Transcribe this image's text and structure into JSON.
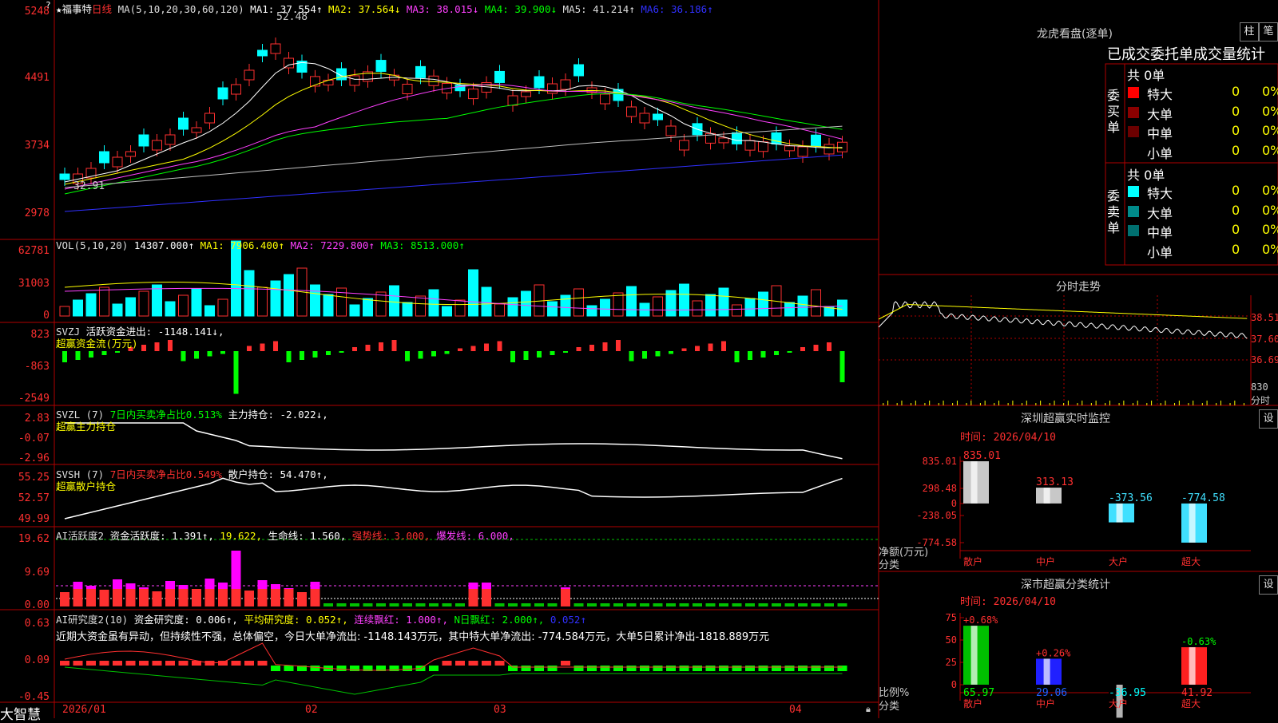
{
  "app": {
    "brand": "大智慧"
  },
  "kline_header": {
    "star": "★",
    "stock_name": "福事特",
    "period": "日线",
    "ma_label": "MA(5,10,20,30,60,120)",
    "ma1": "MA1: 37.554↑",
    "ma2": "MA2: 37.564↓",
    "ma3": "MA3: 38.015↓",
    "ma4": "MA4: 39.900↓",
    "ma5": "MA5: 41.214↑",
    "ma6": "MA6: 36.186↑",
    "high_mark": "52.48",
    "low_mark": "32.91",
    "question_mark": "?"
  },
  "kline_yaxis": [
    "5248",
    "4491",
    "3734",
    "2978"
  ],
  "vol_header": {
    "label": "VOL(5,10,20)",
    "value": "14307.000↑",
    "ma1": "MA1: 7906.400↑",
    "ma2": "MA2: 7229.800↑",
    "ma3": "MA3: 8513.000↑"
  },
  "vol_yaxis": [
    "62781",
    "31003",
    "0"
  ],
  "svzj_header": {
    "label": "SVZJ",
    "text": "活跃资金进出: -1148.141↓,",
    "sub": "超赢资金流(万元)"
  },
  "svzj_yaxis": [
    "823",
    "-863",
    "-2549"
  ],
  "svzl_header": {
    "label": "SVZL (7)",
    "text1": "7日内买卖净占比0.513%",
    "text2": "主力持仓: -2.022↓,",
    "sub": "超赢主力持仓"
  },
  "svzl_yaxis": [
    "2.83",
    "-0.07",
    "-2.96"
  ],
  "svsh_header": {
    "label": "SVSH (7)",
    "text1": "7日内买卖净占比0.549%",
    "text2": "散户持仓: 54.470↑,",
    "sub": "超赢散户持仓"
  },
  "svsh_yaxis": [
    "55.25",
    "52.57",
    "49.99"
  ],
  "ai_active_header": {
    "label": "AI活跃度2",
    "t1": "资金活跃度: 1.391↑,",
    "t2": "19.622,",
    "t3": "生命线: 1.560,",
    "t4": "强势线: 3.000,",
    "t5": "爆发线: 6.000,"
  },
  "ai_active_yaxis": [
    "19.62",
    "9.69",
    "0.00"
  ],
  "ai_research_header": {
    "label": "AI研究度2(10)",
    "t1": "资金研究度: 0.006↑,",
    "t2": "平均研究度: 0.052↑,",
    "t3": "连续飘红: 1.000↑,",
    "t4": "N日飘红: 2.000↑,",
    "t5": "0.052↑",
    "comment": "近期大资金虽有异动，但持续性不强，总体偏空，今日大单净流出: -1148.143万元，其中特大单净流出: -774.584万元，大单5日累计净出-1818.889万元"
  },
  "ai_research_yaxis": [
    "0.63",
    "0.09",
    "-0.45"
  ],
  "xaxis": [
    "2026/01",
    "02",
    "03",
    "04"
  ],
  "dragon": {
    "title": "龙虎看盘(逐单)",
    "btn1": "柱",
    "btn2": "笔",
    "subtitle": "已成交委托单成交量统计",
    "buy_label": "委买单",
    "sell_label": "委卖单",
    "buy_total": "共 0单",
    "sell_total": "共 0单",
    "buy_rows": [
      {
        "name": "特大",
        "qty": "0",
        "pct": "0%",
        "color": "#ff0000"
      },
      {
        "name": "大单",
        "qty": "0",
        "pct": "0%",
        "color": "#8b0000"
      },
      {
        "name": "中单",
        "qty": "0",
        "pct": "0%",
        "color": "#6b0000"
      },
      {
        "name": "小单",
        "qty": "0",
        "pct": "0%",
        "color": "#000000"
      }
    ],
    "sell_rows": [
      {
        "name": "特大",
        "qty": "0",
        "pct": "0%",
        "color": "#00ffff"
      },
      {
        "name": "大单",
        "qty": "0",
        "pct": "0%",
        "color": "#008b8b"
      },
      {
        "name": "中单",
        "qty": "0",
        "pct": "0%",
        "color": "#007070"
      },
      {
        "name": "小单",
        "qty": "0",
        "pct": "0%",
        "color": "#000000"
      }
    ]
  },
  "minute": {
    "title": "分时走势",
    "y": [
      "38.51",
      "37.60",
      "36.69"
    ],
    "vol": "830",
    "vol_label": "分时"
  },
  "sz_monitor": {
    "title": "深圳超赢实时监控",
    "btn": "设",
    "time": "时间: 2026/04/10",
    "yaxis": [
      "835.01",
      "298.48",
      "0",
      "-238.05",
      "-774.58"
    ],
    "ylabel": "净额(万元)",
    "xlabel": "分类",
    "categories": [
      "散户",
      "中户",
      "大户",
      "超大"
    ],
    "values": [
      835.01,
      313.13,
      -373.56,
      -774.58
    ],
    "value_labels": [
      "835.01",
      "313.13",
      "-373.56",
      "-774.58"
    ]
  },
  "sz_class": {
    "title": "深市超赢分类统计",
    "btn": "设",
    "time": "时间: 2026/04/10",
    "yaxis": [
      "75",
      "50",
      "25",
      "0"
    ],
    "ylabel": "比例%",
    "xlabel": "分类",
    "categories": [
      "散户",
      "中户",
      "大户",
      "超大"
    ],
    "values": [
      65.97,
      29.06,
      -36.95,
      41.92
    ],
    "top_labels": [
      "+0.68%",
      "+0.26%",
      "",
      "-0.63%"
    ],
    "bottom_labels": [
      "65.97",
      "29.06",
      "-36.95",
      "41.92"
    ]
  },
  "chart_data": [
    {
      "type": "bar",
      "title": "深圳超赢实时监控",
      "ylabel": "净额(万元)",
      "xlabel": "分类",
      "categories": [
        "散户",
        "中户",
        "大户",
        "超大"
      ],
      "values": [
        835.01,
        313.13,
        -373.56,
        -774.58
      ],
      "ylim": [
        -774.58,
        835.01
      ]
    },
    {
      "type": "bar",
      "title": "深市超赢分类统计",
      "ylabel": "比例%",
      "xlabel": "分类",
      "categories": [
        "散户",
        "中户",
        "大户",
        "超大"
      ],
      "values": [
        65.97,
        29.06,
        -36.95,
        41.92
      ],
      "ylim": [
        0,
        75
      ]
    }
  ],
  "colors": {
    "up": "#ff3030",
    "down": "#00ffff",
    "grid": "#b00000",
    "ma1": "#ffffff",
    "ma2": "#ffff00",
    "ma3": "#ff40ff",
    "ma4": "#00ff00",
    "ma6": "#3030ff"
  }
}
